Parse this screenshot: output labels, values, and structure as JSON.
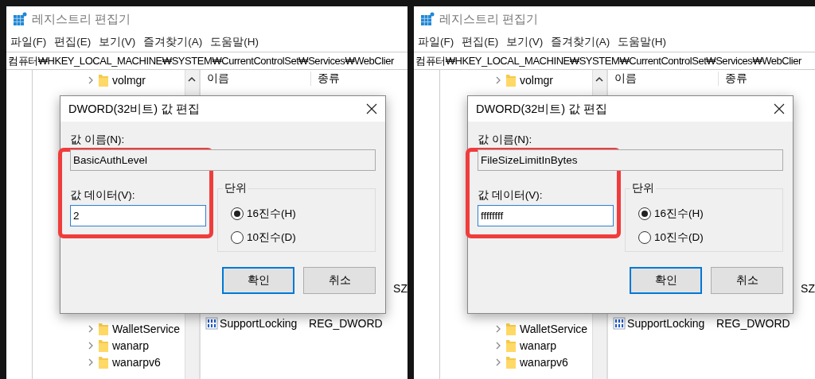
{
  "screens": [
    {
      "window": {
        "title": "레지스트리 편집기"
      },
      "menu": [
        "파일(F)",
        "편집(E)",
        "보기(V)",
        "즐겨찾기(A)",
        "도움말(H)"
      ],
      "address": "컴퓨터₩HKEY_LOCAL_MACHINE₩SYSTEM₩CurrentControlSet₩Services₩WebClier",
      "tree": {
        "top_items": [
          {
            "label": "volmgr",
            "expanded": false
          }
        ],
        "bottom_items": [
          {
            "label": "WalletService",
            "expanded": false
          },
          {
            "label": "wanarp",
            "expanded": false
          },
          {
            "label": "wanarpv6",
            "expanded": false
          }
        ]
      },
      "list": {
        "columns": [
          "이름",
          "종류"
        ],
        "rows": [
          {
            "kind": "partial",
            "column_3": "SZ"
          },
          {
            "kind": "dword",
            "name": "SupportLocking",
            "type": "REG_DWORD"
          }
        ]
      },
      "dialog": {
        "title": "DWORD(32비트) 값 편집",
        "name_label": "값 이름(N):",
        "name_value": "BasicAuthLevel",
        "data_label": "값 데이터(V):",
        "data_value": "2",
        "highlight": true,
        "base_group": {
          "title": "단위",
          "options": [
            {
              "label": "16진수(H)",
              "selected": true
            },
            {
              "label": "10진수(D)",
              "selected": false
            }
          ]
        },
        "buttons": [
          {
            "label": "확인",
            "default": true
          },
          {
            "label": "취소",
            "default": false
          }
        ]
      }
    },
    {
      "window": {
        "title": "레지스트리 편집기"
      },
      "menu": [
        "파일(F)",
        "편집(E)",
        "보기(V)",
        "즐겨찾기(A)",
        "도움말(H)"
      ],
      "address": "컴퓨터₩HKEY_LOCAL_MACHINE₩SYSTEM₩CurrentControlSet₩Services₩WebClier",
      "tree": {
        "top_items": [
          {
            "label": "volmgr",
            "expanded": false
          }
        ],
        "bottom_items": [
          {
            "label": "WalletService",
            "expanded": false
          },
          {
            "label": "wanarp",
            "expanded": false
          },
          {
            "label": "wanarpv6",
            "expanded": false
          }
        ]
      },
      "list": {
        "columns": [
          "이름",
          "종류"
        ],
        "rows": [
          {
            "kind": "partial",
            "column_3": "SZ"
          },
          {
            "kind": "dword",
            "name": "SupportLocking",
            "type": "REG_DWORD"
          }
        ]
      },
      "dialog": {
        "title": "DWORD(32비트) 값 편집",
        "name_label": "값 이름(N):",
        "name_value": "FileSizeLimitInBytes",
        "data_label": "값 데이터(V):",
        "data_value": "ffffffff",
        "highlight": true,
        "base_group": {
          "title": "단위",
          "options": [
            {
              "label": "16진수(H)",
              "selected": true
            },
            {
              "label": "10진수(D)",
              "selected": false
            }
          ]
        },
        "buttons": [
          {
            "label": "확인",
            "default": true
          },
          {
            "label": "취소",
            "default": false
          }
        ]
      }
    }
  ]
}
